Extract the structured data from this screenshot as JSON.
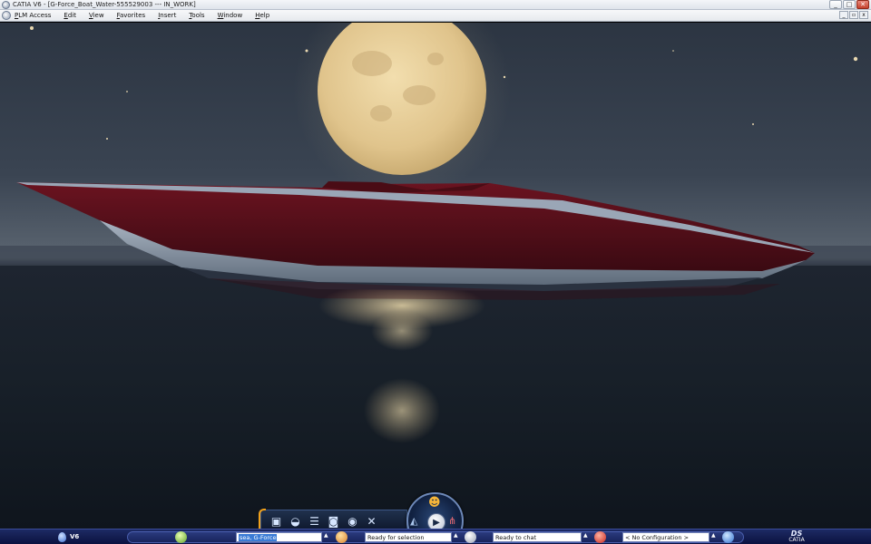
{
  "window": {
    "title": "CATIA V6 - [G-Force_Boat_Water-555529003 --- IN_WORK]",
    "controls": {
      "minimize": "_",
      "maximize": "□",
      "close": "✕"
    }
  },
  "menu": {
    "items": [
      "PLM Access",
      "Edit",
      "View",
      "Favorites",
      "Insert",
      "Tools",
      "Window",
      "Help"
    ],
    "doc_controls": {
      "minimize": "_",
      "restore": "▫",
      "close": "x"
    }
  },
  "scene": {
    "description_colors": {
      "sky_top": "#2c3542",
      "horizon": "#5d6670",
      "water": "#141b24",
      "moon": "#e6cf9a",
      "hull_red": "#5a0f18",
      "hull_white": "#a9b4c2"
    }
  },
  "compass": {
    "pad_icons": [
      "open-icon",
      "surface-icon",
      "layers-icon",
      "snapshot-icon",
      "camera-icon",
      "tools-icon"
    ]
  },
  "statusbar": {
    "brand": "V6",
    "search_value": "sea, G-Force",
    "selection_status": "Ready for selection",
    "chat_status": "Ready to chat",
    "configuration": "< No Configuration >",
    "vendor": "CATIA",
    "vendor_mark": "DS"
  }
}
